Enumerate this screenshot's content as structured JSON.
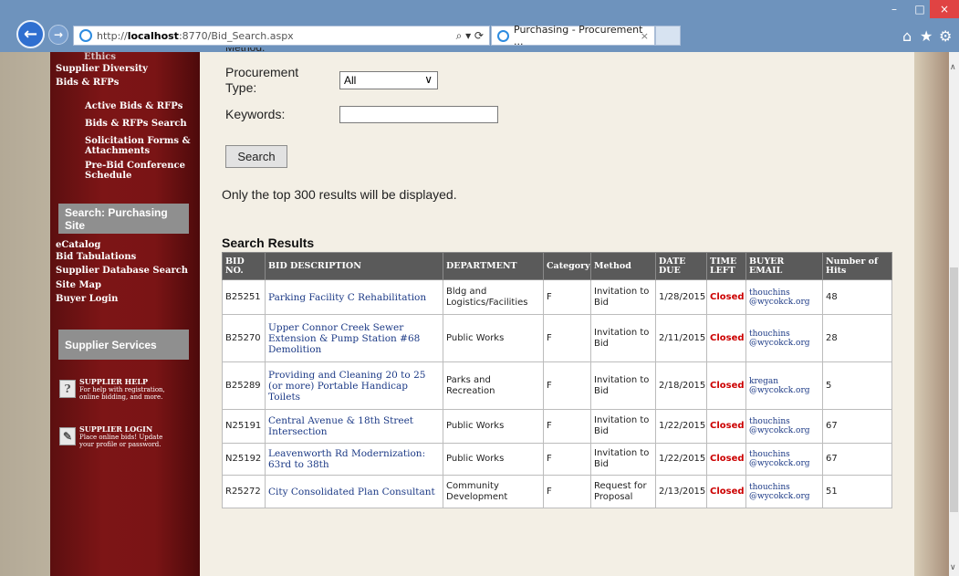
{
  "browser": {
    "url_prefix": "http://",
    "url_host": "localhost",
    "url_rest": ":8770/Bid_Search.aspx",
    "address_controls": "⌕ ▾ ⟳",
    "tab_title": "Purchasing - Procurement ...",
    "tab_close": "×",
    "back": "←",
    "forward": "→",
    "min": "–",
    "max": "□",
    "close": "×",
    "home": "⌂",
    "favorites": "★",
    "settings": "⚙"
  },
  "sidebar": {
    "top_links": [
      {
        "label": "Ethics"
      },
      {
        "label": "Supplier Diversity"
      },
      {
        "label": "Bids & RFPs"
      }
    ],
    "sub_links": [
      {
        "label": "Active Bids & RFPs"
      },
      {
        "label": "Bids & RFPs Search"
      },
      {
        "label": "Solicitation Forms &"
      },
      {
        "label": "Attachments"
      },
      {
        "label": "Pre-Bid Conference"
      },
      {
        "label": "Schedule"
      }
    ],
    "search_header": "Search: Purchasing Site",
    "search_links": [
      {
        "label": "eCatalog"
      },
      {
        "label": "Bid Tabulations"
      },
      {
        "label": "Supplier Database Search"
      },
      {
        "label": "Site Map"
      },
      {
        "label": "Buyer Login"
      }
    ],
    "services_header": "Supplier Services",
    "help_title": "SUPPLIER HELP",
    "help_text_1": "For help with registration,",
    "help_text_2": "online bidding, and more.",
    "help_icon": "?",
    "login_title": "SUPPLIER LOGIN",
    "login_text_1": "Place online bids! Update",
    "login_text_2": "your profile or password.",
    "login_icon": "✎"
  },
  "form": {
    "cut_label": "Method:",
    "procurement_type_label_1": "Procurement",
    "procurement_type_label_2": "Type:",
    "procurement_type_value": "All",
    "select_caret": "∨",
    "keywords_label": "Keywords:",
    "keywords_value": "",
    "search_button": "Search",
    "notice": "Only the top 300 results will be displayed."
  },
  "results": {
    "title": "Search Results",
    "columns": [
      "BID NO.",
      "BID DESCRIPTION",
      "DEPARTMENT",
      "Category",
      "Method",
      "DATE DUE",
      "TIME LEFT",
      "BUYER EMAIL",
      "Number of Hits"
    ],
    "rows": [
      {
        "bid_no": "B25251",
        "description": "Parking Facility C Rehabilitation",
        "department": "Bldg and Logistics/Facilities",
        "category": "F",
        "method": "Invitation to Bid",
        "date_due": "1/28/2015",
        "time_left": "Closed",
        "email": "thouchins @wycokck.org",
        "hits": "48"
      },
      {
        "bid_no": "B25270",
        "description": "Upper Connor Creek Sewer Extension & Pump Station #68 Demolition",
        "department": "Public Works",
        "category": "F",
        "method": "Invitation to Bid",
        "date_due": "2/11/2015",
        "time_left": "Closed",
        "email": "thouchins @wycokck.org",
        "hits": "28"
      },
      {
        "bid_no": "B25289",
        "description": "Providing and Cleaning 20 to 25 (or more) Portable Handicap Toilets",
        "department": "Parks and Recreation",
        "category": "F",
        "method": "Invitation to Bid",
        "date_due": "2/18/2015",
        "time_left": "Closed",
        "email": "kregan @wycokck.org",
        "hits": "5"
      },
      {
        "bid_no": "N25191",
        "description": "Central Avenue & 18th Street Intersection",
        "department": "Public Works",
        "category": "F",
        "method": "Invitation to Bid",
        "date_due": "1/22/2015",
        "time_left": "Closed",
        "email": "thouchins @wycokck.org",
        "hits": "67"
      },
      {
        "bid_no": "N25192",
        "description": "Leavenworth Rd Modernization: 63rd to 38th",
        "department": "Public Works",
        "category": "F",
        "method": "Invitation to Bid",
        "date_due": "1/22/2015",
        "time_left": "Closed",
        "email": "thouchins @wycokck.org",
        "hits": "67"
      },
      {
        "bid_no": "R25272",
        "description": "City Consolidated Plan Consultant",
        "department": "Community Development",
        "category": "F",
        "method": "Request for Proposal",
        "date_due": "2/13/2015",
        "time_left": "Closed",
        "email": "thouchins @wycokck.org",
        "hits": "51"
      }
    ]
  },
  "scroll": {
    "up": "∧",
    "down": "∨"
  }
}
